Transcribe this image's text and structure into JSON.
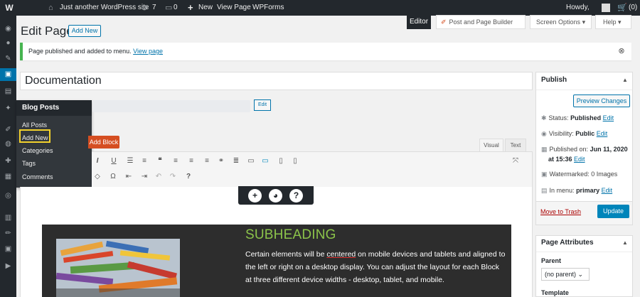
{
  "admin_bar": {
    "site_name": "Just another WordPress site",
    "updates_count": "7",
    "comments_count": "0",
    "new_label": "New",
    "view_page": "View Page",
    "wpforms": "WPForms",
    "howdy": "Howdy,",
    "cart_count": "(0)"
  },
  "flyout": {
    "heading": "Blog Posts",
    "items": [
      "All Posts",
      "Add New",
      "Categories",
      "Tags",
      "Comments"
    ]
  },
  "header": {
    "title": "Edit Page",
    "add_new": "Add New",
    "editor_tab": "Editor",
    "page_builder_tab": "Post and Page Builder",
    "screen_options": "Screen Options",
    "help": "Help"
  },
  "notice": {
    "text": "Page published and added to menu.",
    "link": "View page"
  },
  "post": {
    "title": "Documentation",
    "permalink_edit": "Edit",
    "add_block": "Add Block"
  },
  "editor": {
    "visual_tab": "Visual",
    "text_tab": "Text"
  },
  "content": {
    "subheading": "SUBHEADING",
    "body_before": "Certain elements will be ",
    "body_misspelled": "centered",
    "body_after": " on mobile devices and tablets and aligned to the left or right on a desktop display. You can adjust the layout for each Block at three different device widths - desktop, tablet, and mobile."
  },
  "publish": {
    "title": "Publish",
    "preview": "Preview Changes",
    "status_label": "Status:",
    "status_value": "Published",
    "visibility_label": "Visibility:",
    "visibility_value": "Public",
    "published_label": "Published on:",
    "published_value_1": "Jun 11, 2020",
    "published_value_2": "at 15:36",
    "watermarked": "Watermarked: 0 Images",
    "menu_label": "In menu:",
    "menu_value": "primary",
    "edit_link": "Edit",
    "move_to_trash": "Move to Trash",
    "update": "Update"
  },
  "page_attributes": {
    "title": "Page Attributes",
    "parent_label": "Parent",
    "parent_value": "(no parent)",
    "template_label": "Template"
  },
  "colors": {
    "admin_bar": "#23282d",
    "accent": "#0073aa",
    "notice_border": "#46b450",
    "add_block": "#d54e21",
    "subheading": "#8bc34a",
    "highlight": "#f3d22d"
  },
  "icons": {
    "admin_bar": [
      "wordpress-logo-icon",
      "home-icon",
      "updates-icon",
      "comment-icon",
      "plus-icon",
      "cart-icon"
    ],
    "sidebar": [
      "dashboard-icon",
      "jetpack-icon",
      "posts-icon",
      "media-icon",
      "pages-icon",
      "pin-icon",
      "appearance-icon",
      "plugins-icon",
      "users-icon",
      "tools-icon",
      "settings-icon",
      "globe-icon",
      "forms-icon",
      "pen-icon",
      "camera-icon",
      "play-icon"
    ],
    "floating_toolbar": [
      "plus-icon",
      "globe-icon",
      "question-icon"
    ]
  }
}
